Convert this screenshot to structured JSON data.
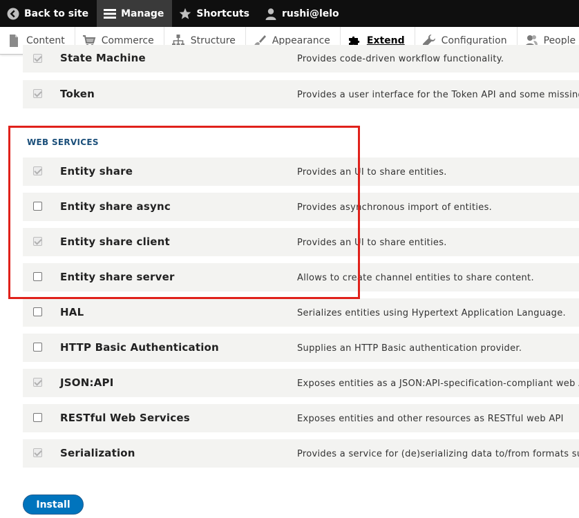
{
  "toolbar": {
    "items": [
      {
        "label": "Back to site",
        "icon": "back-arrow-icon"
      },
      {
        "label": "Manage",
        "icon": "menu-icon"
      },
      {
        "label": "Shortcuts",
        "icon": "star-icon"
      },
      {
        "label": "rushi@lelo",
        "icon": "user-icon"
      }
    ]
  },
  "tray": {
    "items": [
      {
        "label": "Content",
        "icon": "document-icon"
      },
      {
        "label": "Commerce",
        "icon": "cart-icon"
      },
      {
        "label": "Structure",
        "icon": "structure-icon"
      },
      {
        "label": "Appearance",
        "icon": "paintbrush-icon"
      },
      {
        "label": "Extend",
        "icon": "puzzle-icon",
        "active": true
      },
      {
        "label": "Configuration",
        "icon": "wrench-icon"
      },
      {
        "label": "People",
        "icon": "people-icon"
      }
    ]
  },
  "modules_above": [
    {
      "name": "State Machine",
      "description": "Provides code-driven workflow functionality.",
      "checked": true,
      "disabled": true
    },
    {
      "name": "Token",
      "description": "Provides a user interface for the Token API and some missing cor",
      "checked": true,
      "disabled": true
    }
  ],
  "section": {
    "title": "WEB SERVICES",
    "modules": [
      {
        "name": "Entity share",
        "description": "Provides an UI to share entities.",
        "checked": true,
        "disabled": true
      },
      {
        "name": "Entity share async",
        "description": "Provides asynchronous import of entities.",
        "checked": false
      },
      {
        "name": "Entity share client",
        "description": "Provides an UI to share entities.",
        "checked": true,
        "disabled": true
      },
      {
        "name": "Entity share server",
        "description": "Allows to create channel entities to share content.",
        "checked": false
      },
      {
        "name": "HAL",
        "description": "Serializes entities using Hypertext Application Language.",
        "checked": false
      },
      {
        "name": "HTTP Basic Authentication",
        "description": "Supplies an HTTP Basic authentication provider.",
        "checked": false
      },
      {
        "name": "JSON:API",
        "description": "Exposes entities as a JSON:API-specification-compliant web API.",
        "checked": true,
        "disabled": true
      },
      {
        "name": "RESTful Web Services",
        "description": "Exposes entities and other resources as RESTful web API",
        "checked": false
      },
      {
        "name": "Serialization",
        "description": "Provides a service for (de)serializing data to/from formats such a",
        "checked": true,
        "disabled": true
      }
    ]
  },
  "install_button": "Install",
  "colors": {
    "toolbar_bg": "#0f0f0f",
    "row_bg": "#f3f3f1",
    "section_title": "#1b4f7a",
    "highlight": "#e0211b",
    "button": "#0074bd"
  }
}
